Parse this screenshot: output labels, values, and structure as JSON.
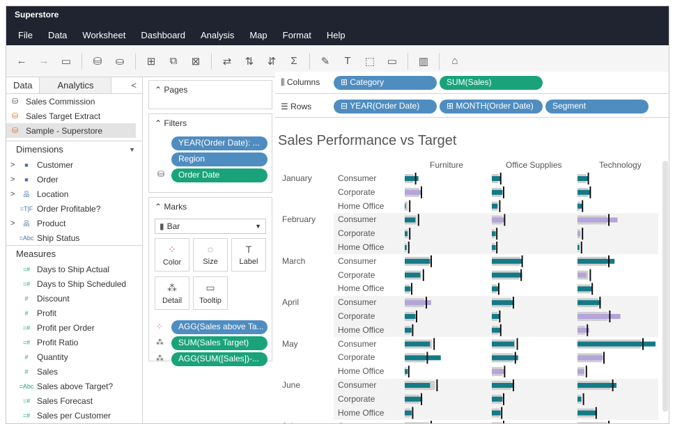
{
  "app": {
    "title": "Superstore"
  },
  "menu": [
    "File",
    "Data",
    "Worksheet",
    "Dashboard",
    "Analysis",
    "Map",
    "Format",
    "Help"
  ],
  "toolbar": {
    "icons": [
      "back-arrow-icon",
      "forward-arrow-icon",
      "save-icon",
      "new-datasource-icon",
      "pause-updates-icon",
      "new-worksheet-icon",
      "duplicate-sheet-icon",
      "clear-sheet-icon",
      "swap-icon",
      "sort-ascending-icon",
      "sort-descending-icon",
      "totals-icon",
      "highlight-icon",
      "labels-icon",
      "group-icon",
      "fit-icon",
      "show-me-icon",
      "tooltip-icon"
    ]
  },
  "data_pane": {
    "tab_data": "Data",
    "tab_analytics": "Analytics",
    "collapse": "<",
    "datasources": [
      {
        "label": "Sales Commission",
        "icon": "database-icon"
      },
      {
        "label": "Sales Target Extract",
        "icon": "extract-icon"
      },
      {
        "label": "Sample - Superstore",
        "icon": "extract-icon"
      }
    ],
    "dimensions_header": "Dimensions",
    "dimensions": [
      {
        "label": "Customer",
        "icon": "folder-icon",
        "glyph": "■",
        "expand": ">"
      },
      {
        "label": "Order",
        "icon": "folder-icon",
        "glyph": "■",
        "expand": ">"
      },
      {
        "label": "Location",
        "icon": "hierarchy-icon",
        "glyph": "品",
        "expand": ">"
      },
      {
        "label": "Order Profitable?",
        "icon": "boolean-icon",
        "glyph": "=T|F",
        "expand": ""
      },
      {
        "label": "Product",
        "icon": "hierarchy-icon",
        "glyph": "品",
        "expand": ">"
      },
      {
        "label": "Ship Status",
        "icon": "string-icon",
        "glyph": "=Abc",
        "expand": ""
      }
    ],
    "measures_header": "Measures",
    "measures": [
      {
        "label": "Days to Ship Actual",
        "glyph": "=#"
      },
      {
        "label": "Days to Ship Scheduled",
        "glyph": "=#"
      },
      {
        "label": "Discount",
        "glyph": "#"
      },
      {
        "label": "Profit",
        "glyph": "#"
      },
      {
        "label": "Profit per Order",
        "glyph": "=#"
      },
      {
        "label": "Profit Ratio",
        "glyph": "=#"
      },
      {
        "label": "Quantity",
        "glyph": "#"
      },
      {
        "label": "Sales",
        "glyph": "#"
      },
      {
        "label": "Sales above Target?",
        "glyph": "=Abc"
      },
      {
        "label": "Sales Forecast",
        "glyph": "=#"
      },
      {
        "label": "Sales per Customer",
        "glyph": "=#"
      }
    ]
  },
  "shelves": {
    "pages": "Pages",
    "filters": "Filters",
    "filter_pills": [
      "YEAR(Order Date): ...",
      "Region",
      "Order Date"
    ],
    "marks": "Marks",
    "mark_type": "Bar",
    "mark_buttons": [
      "Color",
      "Size",
      "Label",
      "Detail",
      "Tooltip"
    ],
    "mark_pills": [
      "AGG(Sales above Ta...",
      "SUM(Sales Target)",
      "AGG(SUM([Sales])-..."
    ],
    "columns_label": "Columns",
    "columns": [
      "Category",
      "SUM(Sales)"
    ],
    "rows_label": "Rows",
    "rows": [
      "YEAR(Order Date)",
      "MONTH(Order Date)",
      "Segment"
    ]
  },
  "colors": {
    "teal": "#137a86",
    "lavender": "#b3a4d9",
    "target": "#cfcfcf",
    "pill_blue": "#4f8dc0",
    "pill_green": "#1aa37a",
    "menubar": "#1f2430"
  },
  "chart_data": {
    "type": "bar",
    "title": "Sales Performance vs Target",
    "categories": [
      "Furniture",
      "Office Supplies",
      "Technology"
    ],
    "months": [
      "January",
      "February",
      "March",
      "April",
      "May",
      "June",
      "July"
    ],
    "segments": [
      "Consumer",
      "Corporate",
      "Home Office"
    ],
    "rows": [
      {
        "month": "January",
        "segment": "Consumer",
        "values": [
          0.28,
          0.18,
          0.22
        ],
        "targets": [
          0.18,
          0.14,
          0.18
        ],
        "above": [
          true,
          true,
          true
        ]
      },
      {
        "month": "January",
        "segment": "Corporate",
        "values": [
          0.34,
          0.22,
          0.26
        ],
        "targets": [
          0.3,
          0.2,
          0.22
        ],
        "above": [
          false,
          true,
          true
        ]
      },
      {
        "month": "January",
        "segment": "Home Office",
        "values": [
          0.02,
          0.12,
          0.1
        ],
        "targets": [
          0.06,
          0.12,
          0.06
        ],
        "above": [
          true,
          true,
          true
        ]
      },
      {
        "month": "February",
        "segment": "Consumer",
        "values": [
          0.22,
          0.26,
          0.82
        ],
        "targets": [
          0.24,
          0.22,
          0.6
        ],
        "above": [
          true,
          false,
          false
        ]
      },
      {
        "month": "February",
        "segment": "Corporate",
        "values": [
          0.06,
          0.08,
          0.06
        ],
        "targets": [
          0.06,
          0.06,
          0.06
        ],
        "above": [
          true,
          true,
          false
        ]
      },
      {
        "month": "February",
        "segment": "Home Office",
        "values": [
          0.04,
          0.08,
          0.04
        ],
        "targets": [
          0.04,
          0.06,
          0.04
        ],
        "above": [
          true,
          true,
          true
        ]
      },
      {
        "month": "March",
        "segment": "Consumer",
        "values": [
          0.52,
          0.62,
          0.76
        ],
        "targets": [
          0.5,
          0.58,
          0.6
        ],
        "above": [
          true,
          true,
          true
        ]
      },
      {
        "month": "March",
        "segment": "Corporate",
        "values": [
          0.32,
          0.62,
          0.18
        ],
        "targets": [
          0.34,
          0.56,
          0.22
        ],
        "above": [
          true,
          true,
          false
        ]
      },
      {
        "month": "March",
        "segment": "Home Office",
        "values": [
          0.12,
          0.14,
          0.3
        ],
        "targets": [
          0.1,
          0.1,
          0.26
        ],
        "above": [
          true,
          true,
          true
        ]
      },
      {
        "month": "April",
        "segment": "Consumer",
        "values": [
          0.54,
          0.46,
          0.48
        ],
        "targets": [
          0.4,
          0.4,
          0.42
        ],
        "above": [
          false,
          true,
          true
        ]
      },
      {
        "month": "April",
        "segment": "Corporate",
        "values": [
          0.22,
          0.16,
          0.88
        ],
        "targets": [
          0.2,
          0.12,
          0.62
        ],
        "above": [
          true,
          true,
          false
        ]
      },
      {
        "month": "April",
        "segment": "Home Office",
        "values": [
          0.14,
          0.18,
          0.24
        ],
        "targets": [
          0.12,
          0.14,
          0.16
        ],
        "above": [
          true,
          true,
          false
        ]
      },
      {
        "month": "May",
        "segment": "Consumer",
        "values": [
          0.52,
          0.46,
          1.6
        ],
        "targets": [
          0.56,
          0.48,
          1.3
        ],
        "above": [
          true,
          true,
          true
        ]
      },
      {
        "month": "May",
        "segment": "Corporate",
        "values": [
          0.74,
          0.54,
          0.52
        ],
        "targets": [
          0.42,
          0.44,
          0.5
        ],
        "above": [
          true,
          true,
          false
        ]
      },
      {
        "month": "May",
        "segment": "Home Office",
        "values": [
          0.06,
          0.26,
          0.14
        ],
        "targets": [
          0.04,
          0.22,
          0.14
        ],
        "above": [
          true,
          false,
          false
        ]
      },
      {
        "month": "June",
        "segment": "Consumer",
        "values": [
          0.52,
          0.46,
          0.8
        ],
        "targets": [
          0.62,
          0.4,
          0.68
        ],
        "above": [
          true,
          true,
          true
        ]
      },
      {
        "month": "June",
        "segment": "Corporate",
        "values": [
          0.36,
          0.22,
          0.08
        ],
        "targets": [
          0.3,
          0.2,
          0.08
        ],
        "above": [
          true,
          true,
          true
        ]
      },
      {
        "month": "June",
        "segment": "Home Office",
        "values": [
          0.14,
          0.18,
          0.4
        ],
        "targets": [
          0.12,
          0.16,
          0.34
        ],
        "above": [
          true,
          true,
          true
        ]
      },
      {
        "month": "July",
        "segment": "Consumer",
        "values": [
          0.54,
          0.2,
          0.8
        ],
        "targets": [
          0.5,
          0.2,
          0.6
        ],
        "above": [
          true,
          true,
          true
        ]
      }
    ]
  }
}
